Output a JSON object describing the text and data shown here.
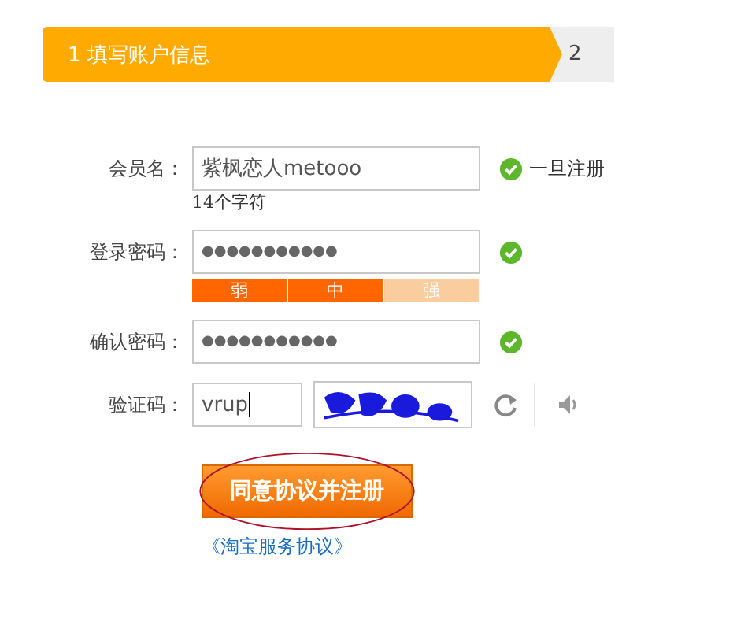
{
  "steps": [
    {
      "label": "1 填写账户信息",
      "selected": true
    },
    {
      "label": "2",
      "selected": false
    }
  ],
  "fields": [
    {
      "kind": "text",
      "label": "会员名：",
      "value": "紫枫恋人metooo",
      "valid": true,
      "tip": "一旦注册",
      "hint": "14个字符"
    },
    {
      "kind": "password",
      "label": "登录密码：",
      "value": "●●●●●●●●●●●",
      "valid": true,
      "strength": [
        {
          "label": "弱",
          "on": true
        },
        {
          "label": "中",
          "on": true
        },
        {
          "label": "强",
          "on": false
        }
      ]
    },
    {
      "kind": "password",
      "label": "确认密码：",
      "value": "●●●●●●●●●●●",
      "valid": true
    },
    {
      "kind": "captcha",
      "label": "验证码：",
      "value": "vrup"
    }
  ],
  "submit": {
    "label": "同意协议并注册",
    "circled": true
  },
  "agreement_link": "《淘宝服务协议》"
}
